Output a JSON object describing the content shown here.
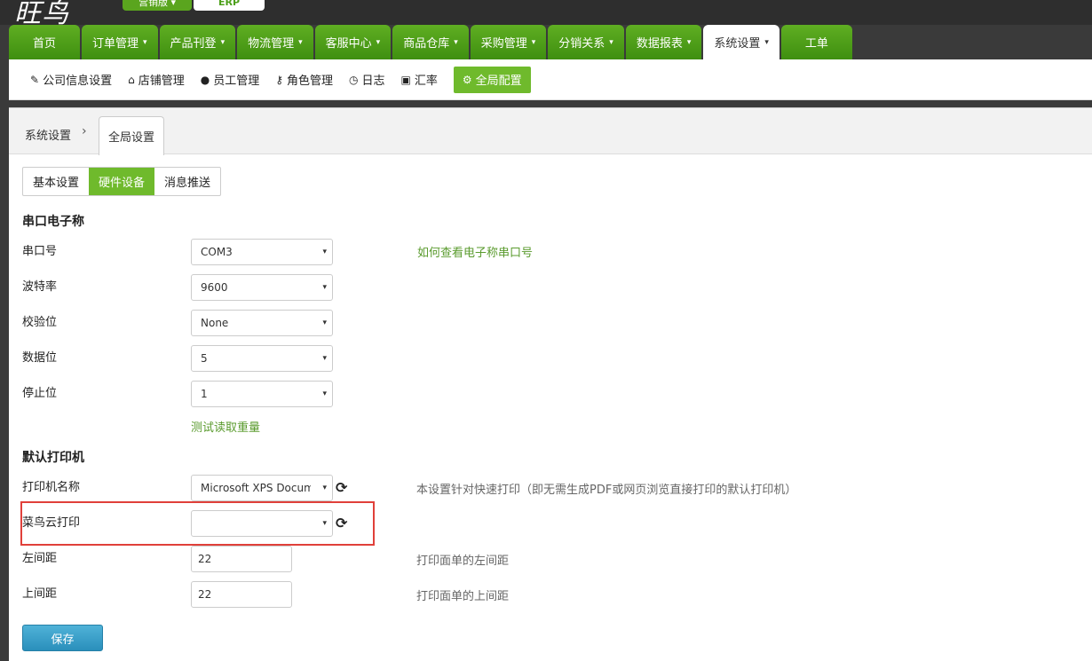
{
  "header": {
    "logo": "旺鸟",
    "edition_label": "营销版",
    "erp_label": "ERP"
  },
  "main_nav": [
    {
      "label": "首页",
      "dropdown": false
    },
    {
      "label": "订单管理",
      "dropdown": true
    },
    {
      "label": "产品刊登",
      "dropdown": true
    },
    {
      "label": "物流管理",
      "dropdown": true
    },
    {
      "label": "客服中心",
      "dropdown": true
    },
    {
      "label": "商品仓库",
      "dropdown": true
    },
    {
      "label": "采购管理",
      "dropdown": true
    },
    {
      "label": "分销关系",
      "dropdown": true
    },
    {
      "label": "数据报表",
      "dropdown": true
    },
    {
      "label": "系统设置",
      "dropdown": true,
      "active": true
    },
    {
      "label": "工单",
      "dropdown": false
    }
  ],
  "sub_nav": [
    {
      "label": "公司信息设置",
      "icon": "edit-icon",
      "glyph": "✎"
    },
    {
      "label": "店铺管理",
      "icon": "home-icon",
      "glyph": "⌂"
    },
    {
      "label": "员工管理",
      "icon": "user-icon",
      "glyph": "●"
    },
    {
      "label": "角色管理",
      "icon": "key-icon",
      "glyph": "⚷"
    },
    {
      "label": "日志",
      "icon": "clock-icon",
      "glyph": "◷"
    },
    {
      "label": "汇率",
      "icon": "money-icon",
      "glyph": "▣"
    },
    {
      "label": "全局配置",
      "icon": "gear-icon",
      "glyph": "⚙",
      "active": true
    }
  ],
  "breadcrumb": {
    "root": "系统设置",
    "separator": "›",
    "current": "全局设置"
  },
  "tabs": [
    {
      "label": "基本设置"
    },
    {
      "label": "硬件设备",
      "active": true
    },
    {
      "label": "消息推送"
    }
  ],
  "serial_scale": {
    "title": "串口电子称",
    "port_label": "串口号",
    "port_value": "COM3",
    "port_help_link": "如何查看电子称串口号",
    "baud_label": "波特率",
    "baud_value": "9600",
    "parity_label": "校验位",
    "parity_value": "None",
    "databits_label": "数据位",
    "databits_value": "5",
    "stopbits_label": "停止位",
    "stopbits_value": "1",
    "test_link": "测试读取重量"
  },
  "printer": {
    "title": "默认打印机",
    "name_label": "打印机名称",
    "name_value": "Microsoft XPS Docum",
    "name_hint": "本设置针对快速打印（即无需生成PDF或网页浏览直接打印的默认打印机）",
    "cainiao_label": "菜鸟云打印",
    "cainiao_value": "",
    "left_margin_label": "左间距",
    "left_margin_value": "22",
    "left_margin_hint": "打印面单的左间距",
    "top_margin_label": "上间距",
    "top_margin_value": "22",
    "top_margin_hint": "打印面单的上间距"
  },
  "icons": {
    "caret": "▾",
    "select_arrow": "▾",
    "refresh": "⟳"
  },
  "actions": {
    "save_label": "保存"
  },
  "colors": {
    "accent": "#6fba2c",
    "nav_green": "#4c9f1a",
    "link_green": "#5a9b2e",
    "save_blue": "#3a9fc9",
    "highlight_red": "#e0403a"
  }
}
